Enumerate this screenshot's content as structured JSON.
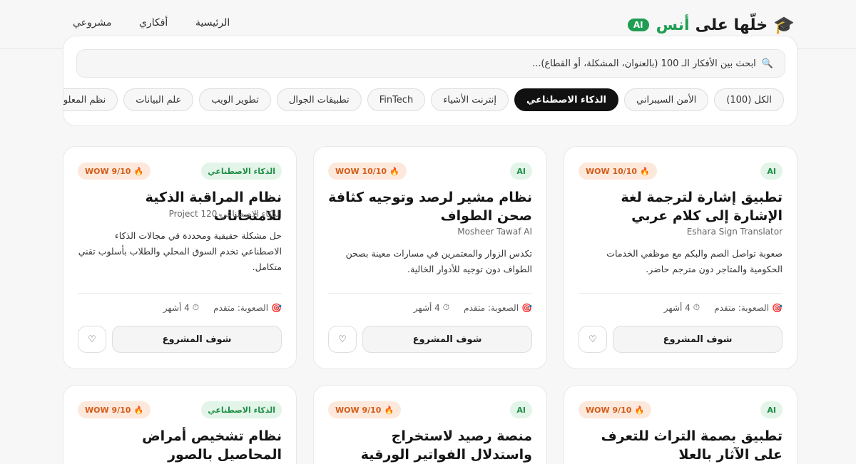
{
  "header": {
    "brand_title": "خلّها على",
    "brand_name": "أنس",
    "brand_badge": "AI",
    "nav": [
      "الرئيسية",
      "أفكاري",
      "مشروعي"
    ]
  },
  "search": {
    "placeholder": "ابحث بين الأفكار الـ 100 (بالعنوان، المشكلة، أو القطاع)..."
  },
  "filters": {
    "chips": [
      "الكل (100)",
      "الأمن السيبراني",
      "الذكاء الاصطناعي",
      "إنترنت الأشياء",
      "FinTech",
      "تطبيقات الجوال",
      "تطوير الويب",
      "علم البيانات",
      "نظم المعلوما"
    ],
    "active_index": 2
  },
  "cards": [
    {
      "tag": "AI",
      "wow": "WOW 10/10",
      "title": "تطبيق إشارة لترجمة لغة الإشارة إلى كلام عربي",
      "subtitle": "Eshara Sign Translator",
      "desc": "صعوبة تواصل الصم والبكم مع موظفي الخدمات الحكومية والمتاجر دون مترجم حاضر.",
      "difficulty": "الصعوبة: متقدم",
      "duration": "4 أشهر",
      "cta": "شوف المشروع"
    },
    {
      "tag": "AI",
      "wow": "WOW 10/10",
      "title": "نظام مشير لرصد وتوجيه كثافة صحن الطواف",
      "subtitle": "Mosheer Tawaf AI",
      "desc": "تكدس الزوار والمعتمرين في مسارات معينة بصحن الطواف دون توجيه للأدوار الخالية.",
      "difficulty": "الصعوبة: متقدم",
      "duration": "4 أشهر",
      "cta": "شوف المشروع"
    },
    {
      "tag": "الذكاء الاصطناعي",
      "wow": "WOW 9/10",
      "title": "نظام المراقبة الذكية للامتحانات",
      "subtitle": "الذكاء الاصطناعي Project 120",
      "desc": "حل مشكلة حقيقية ومحددة في مجالات الذكاء الاصطناعي تخدم السوق المحلي والطلاب بأسلوب تقني متكامل.",
      "difficulty": "الصعوبة: متقدم",
      "duration": "4 أشهر",
      "cta": "شوف المشروع"
    },
    {
      "tag": "AI",
      "wow": "WOW 9/10",
      "title": "تطبيق بصمة التراث للتعرف على الآثار بالعلا",
      "subtitle": "",
      "desc": "",
      "difficulty": "",
      "duration": "",
      "cta": ""
    },
    {
      "tag": "AI",
      "wow": "WOW 9/10",
      "title": "منصة رصيد لاستخراج واستدلال الفواتير الورقية",
      "subtitle": "",
      "desc": "",
      "difficulty": "",
      "duration": "",
      "cta": ""
    },
    {
      "tag": "الذكاء الاصطناعي",
      "wow": "WOW 9/10",
      "title": "نظام تشخيص أمراض المحاصيل بالصور",
      "subtitle": "",
      "desc": "",
      "difficulty": "",
      "duration": "",
      "cta": ""
    }
  ],
  "icons": {
    "brand": "graduation-cap-icon",
    "search": "magnifier-icon",
    "wow": "fire-icon",
    "difficulty": "target-icon",
    "duration": "stopwatch-icon",
    "favorite": "heart-icon"
  },
  "colors": {
    "accent_green": "#1f9d52",
    "active_chip": "#111111",
    "wow_orange": "#d35c1a"
  }
}
